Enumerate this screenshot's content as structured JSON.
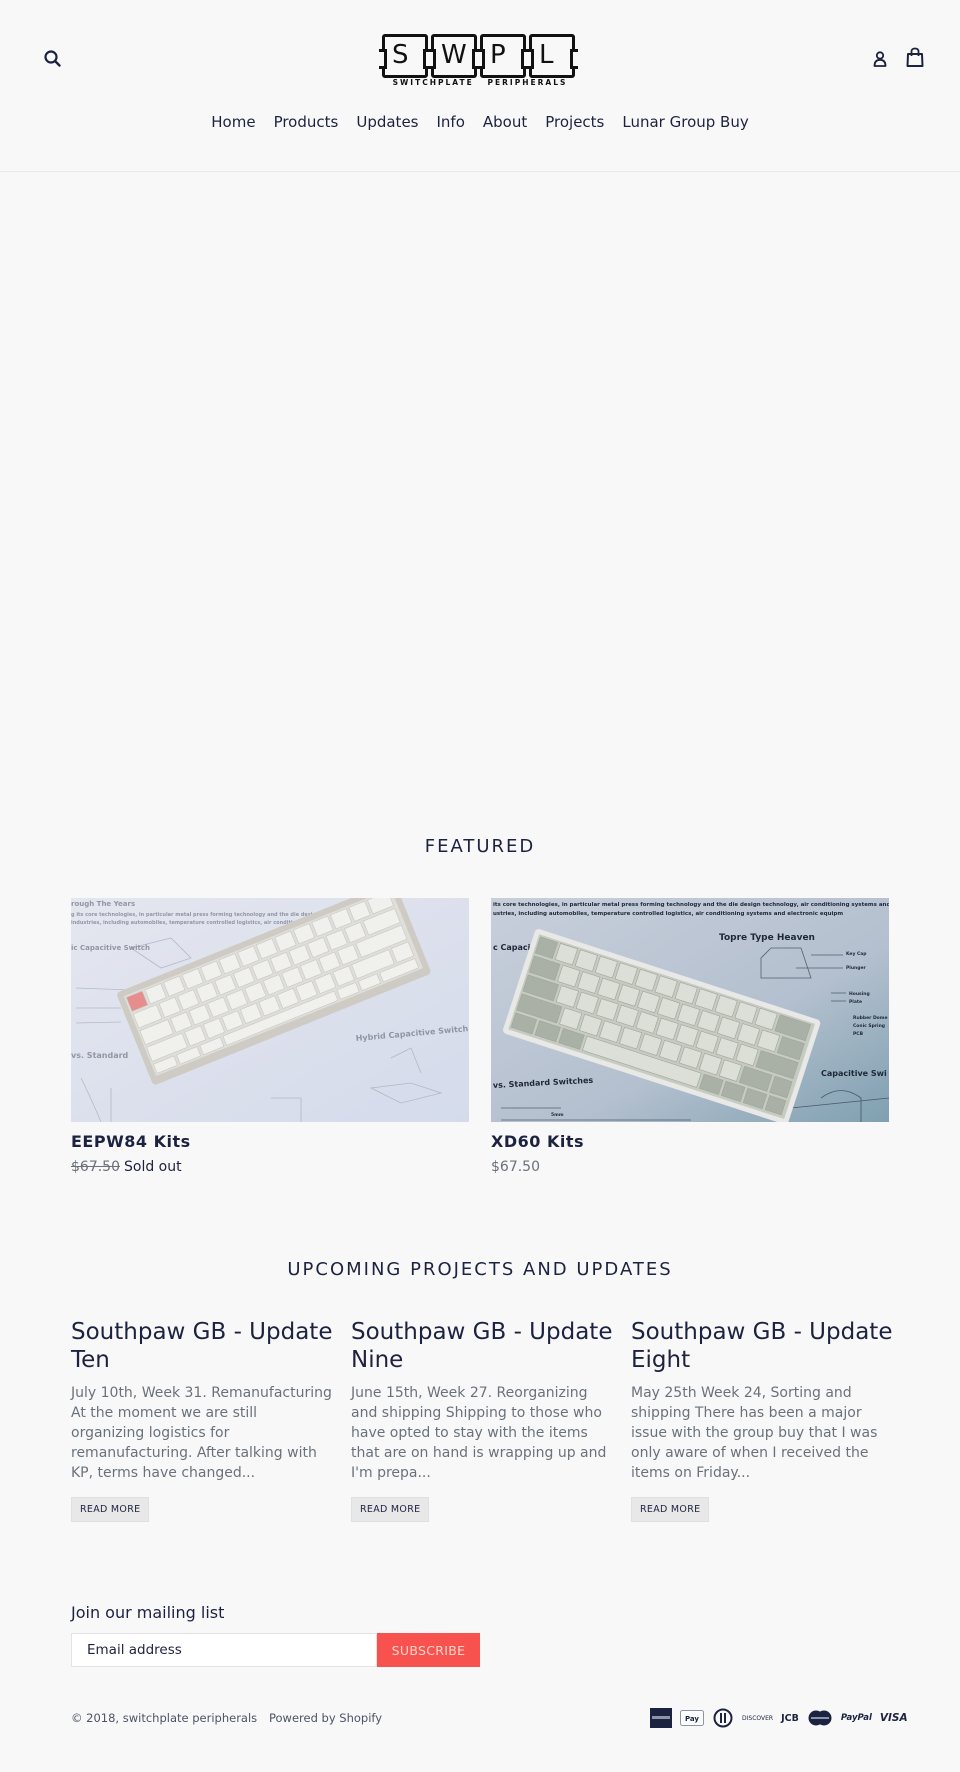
{
  "header": {
    "logo": {
      "letters": [
        "S",
        "W",
        "P",
        "L"
      ],
      "tagline": "SWITCHPLATE   PERIPHERALS"
    },
    "icons": {
      "search": "search-icon",
      "account": "user-icon",
      "cart": "shopping-bag-icon"
    },
    "nav": [
      {
        "label": "Home"
      },
      {
        "label": "Products"
      },
      {
        "label": "Updates"
      },
      {
        "label": "Info"
      },
      {
        "label": "About"
      },
      {
        "label": "Projects"
      },
      {
        "label": "Lunar Group Buy"
      }
    ]
  },
  "featured": {
    "title": "FEATURED",
    "products": [
      {
        "title": "EEPW84 Kits",
        "price": "$67.50",
        "status": "Sold out",
        "on_sale": false,
        "sold_out": true,
        "image": "keyboard-photo-eepw84"
      },
      {
        "title": "XD60 Kits",
        "price": "$67.50",
        "status": "",
        "sold_out": false,
        "image": "keyboard-photo-xd60"
      }
    ]
  },
  "blog": {
    "title": "UPCOMING PROJECTS AND UPDATES",
    "articles": [
      {
        "title": "Southpaw GB - Update Ten",
        "excerpt": "July 10th, Week 31. Remanufacturing At the moment we are still organizing logistics for remanufacturing. After talking with KP, terms have changed...",
        "read_more": "READ MORE"
      },
      {
        "title": "Southpaw GB - Update Nine",
        "excerpt": "June 15th, Week 27. Reorganizing and shipping Shipping to those who have opted to stay with the items that are on hand is wrapping up and I'm prepa...",
        "read_more": "READ MORE"
      },
      {
        "title": "Southpaw GB - Update Eight",
        "excerpt": "May 25th Week 24, Sorting and shipping There has been a major issue with the group buy that I was only aware of when I received the items on Friday...",
        "read_more": "READ MORE"
      }
    ]
  },
  "newsletter": {
    "title": "Join our mailing list",
    "email_placeholder": "Email address",
    "email_value": "",
    "subscribe_label": "SUBSCRIBE"
  },
  "footer": {
    "copyright_prefix": "© 2018, ",
    "store_name": "switchplate peripherals",
    "powered_by": "Powered by Shopify",
    "payment_icons": [
      {
        "name": "american-express",
        "label": "AMERICAN EXPRESS"
      },
      {
        "name": "apple-pay",
        "label": "Pay"
      },
      {
        "name": "diners-club",
        "label": ""
      },
      {
        "name": "discover",
        "label": "DISCOVER"
      },
      {
        "name": "jcb",
        "label": "JCB"
      },
      {
        "name": "master",
        "label": "MasterCard"
      },
      {
        "name": "paypal",
        "label": "PayPal"
      },
      {
        "name": "visa",
        "label": "VISA"
      }
    ]
  },
  "colors": {
    "background": "#f8f8f8",
    "text": "#1c2340",
    "muted": "#69727b",
    "accent": "#f7524e"
  }
}
